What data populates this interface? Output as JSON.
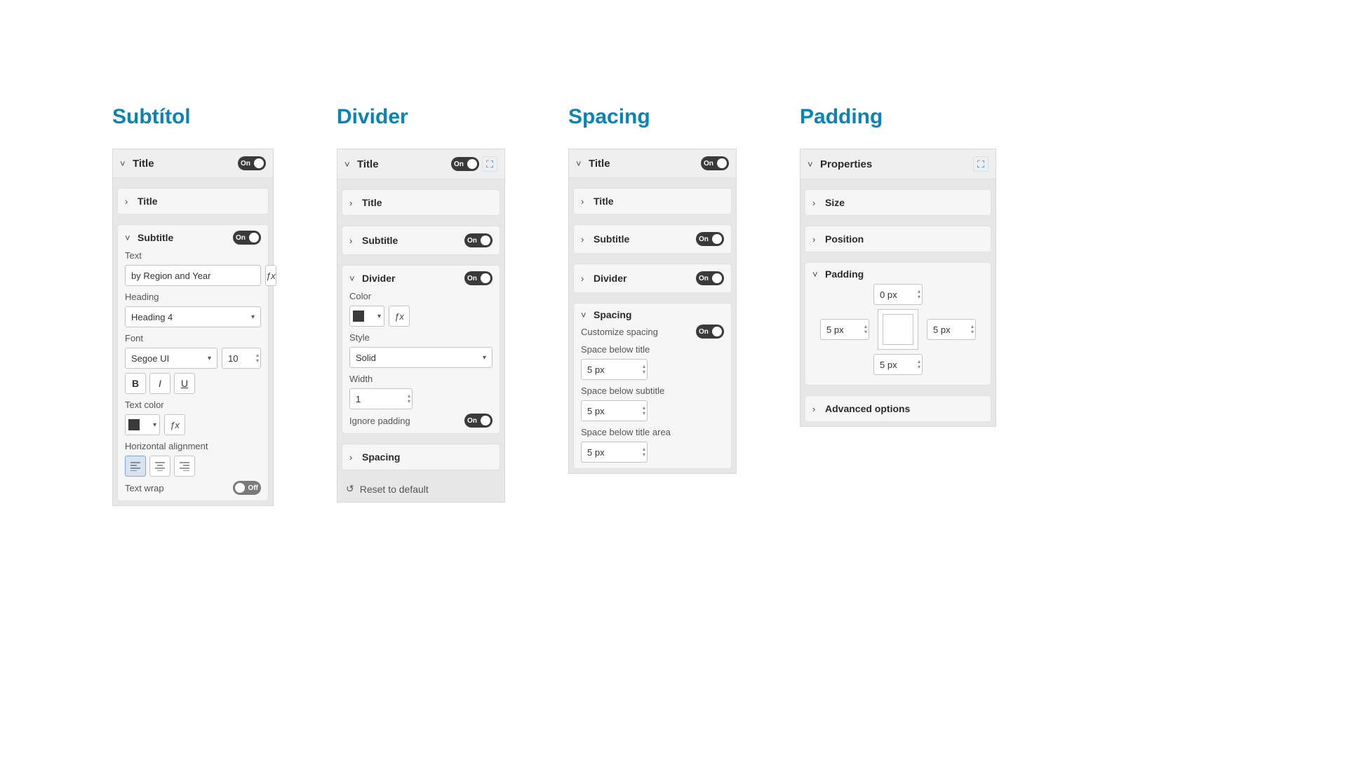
{
  "headings": {
    "subtitol": "Subtítol",
    "divider": "Divider",
    "spacing": "Spacing",
    "padding": "Padding"
  },
  "toggles": {
    "on": "On",
    "off": "Off"
  },
  "panel1": {
    "top": {
      "title": "Title"
    },
    "title_row": {
      "label": "Title"
    },
    "subtitle": {
      "label": "Subtitle",
      "text_label": "Text",
      "text_value": "by Region and Year",
      "heading_label": "Heading",
      "heading_value": "Heading 4",
      "font_label": "Font",
      "font_value": "Segoe UI",
      "font_size": "10",
      "color_label": "Text color",
      "align_label": "Horizontal alignment",
      "wrap_label": "Text wrap"
    }
  },
  "panel2": {
    "top": {
      "title": "Title"
    },
    "title_row": {
      "label": "Title"
    },
    "subtitle_row": {
      "label": "Subtitle"
    },
    "divider": {
      "label": "Divider",
      "color_label": "Color",
      "style_label": "Style",
      "style_value": "Solid",
      "width_label": "Width",
      "width_value": "1",
      "ignore_label": "Ignore padding"
    },
    "spacing_row": {
      "label": "Spacing"
    },
    "reset": "Reset to default"
  },
  "panel3": {
    "top": {
      "title": "Title"
    },
    "title_row": {
      "label": "Title"
    },
    "subtitle_row": {
      "label": "Subtitle"
    },
    "divider_row": {
      "label": "Divider"
    },
    "spacing": {
      "label": "Spacing",
      "customize_label": "Customize spacing",
      "below_title_label": "Space below title",
      "below_title_value": "5 px",
      "below_subtitle_label": "Space below subtitle",
      "below_subtitle_value": "5 px",
      "below_area_label": "Space below title area",
      "below_area_value": "5 px"
    }
  },
  "panel4": {
    "top": {
      "title": "Properties"
    },
    "size_row": {
      "label": "Size"
    },
    "position_row": {
      "label": "Position"
    },
    "padding": {
      "label": "Padding",
      "top": "0 px",
      "left": "5 px",
      "right": "5 px",
      "bottom": "5 px"
    },
    "advanced_row": {
      "label": "Advanced options"
    }
  }
}
